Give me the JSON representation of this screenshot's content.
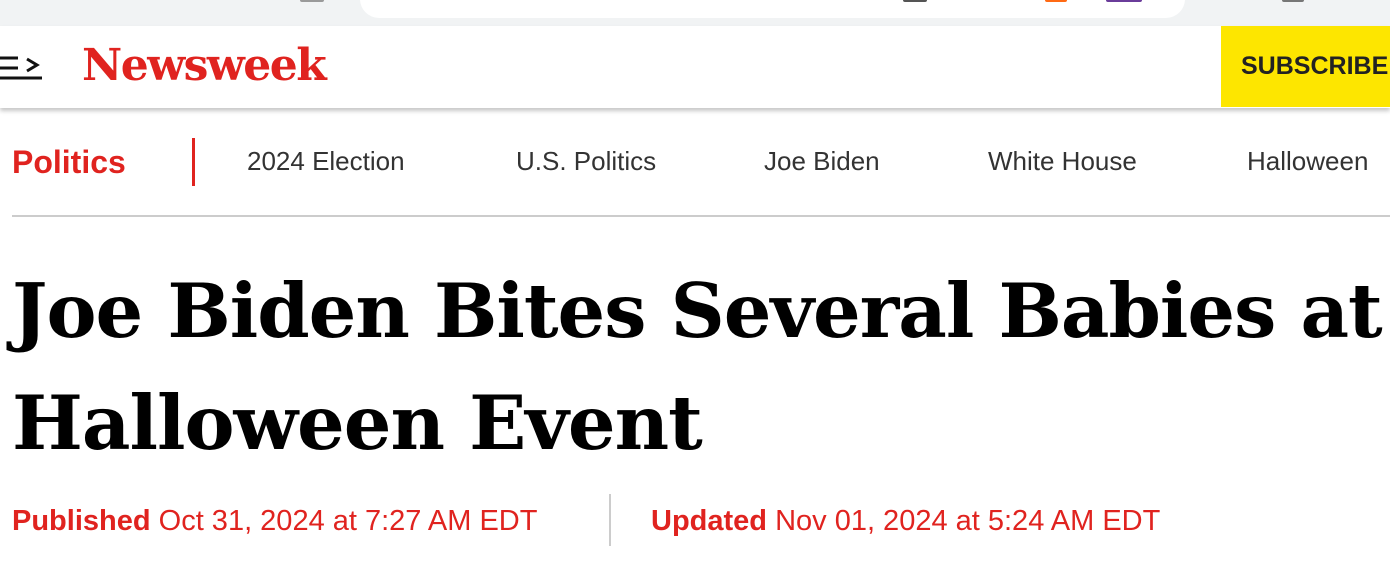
{
  "site": {
    "logo_text": "Newsweek",
    "subscribe_label": "SUBSCRIBE"
  },
  "nav": {
    "section": "Politics",
    "links": [
      "2024 Election",
      "U.S. Politics",
      "Joe Biden",
      "White House",
      "Halloween"
    ]
  },
  "article": {
    "headline": "Joe Biden Bites Several Babies at Halloween Event",
    "published_label": "Published",
    "published_date": "Oct 31, 2024 at 7:27 AM EDT",
    "updated_label": "Updated",
    "updated_date": "Nov 01, 2024 at 5:24 AM EDT"
  },
  "colors": {
    "brand_red": "#e0231f",
    "subscribe_bg": "#fde600",
    "text_dark": "#111111"
  },
  "icons": {
    "menu": "menu-icon"
  }
}
